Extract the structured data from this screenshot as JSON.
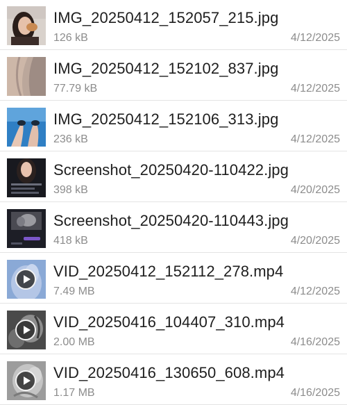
{
  "files": [
    {
      "name": "IMG_20250412_152057_215.jpg",
      "size": "126 kB",
      "date": "4/12/2025",
      "type": "image"
    },
    {
      "name": "IMG_20250412_152102_837.jpg",
      "size": "77.79 kB",
      "date": "4/12/2025",
      "type": "image"
    },
    {
      "name": "IMG_20250412_152106_313.jpg",
      "size": "236 kB",
      "date": "4/12/2025",
      "type": "image"
    },
    {
      "name": "Screenshot_20250420-110422.jpg",
      "size": "398 kB",
      "date": "4/20/2025",
      "type": "image"
    },
    {
      "name": "Screenshot_20250420-110443.jpg",
      "size": "418 kB",
      "date": "4/20/2025",
      "type": "image"
    },
    {
      "name": "VID_20250412_152112_278.mp4",
      "size": "7.49 MB",
      "date": "4/12/2025",
      "type": "video"
    },
    {
      "name": "VID_20250416_104407_310.mp4",
      "size": "2.00 MB",
      "date": "4/16/2025",
      "type": "video"
    },
    {
      "name": "VID_20250416_130650_608.mp4",
      "size": "1.17 MB",
      "date": "4/16/2025",
      "type": "video"
    }
  ],
  "icons": {
    "video_overlay": "play-icon"
  }
}
